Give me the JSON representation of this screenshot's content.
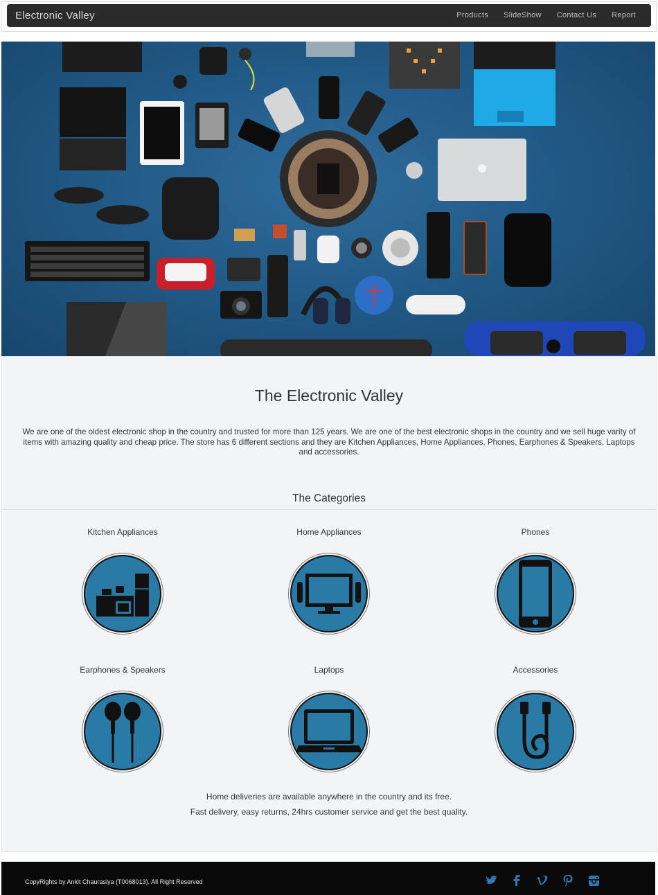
{
  "nav": {
    "brand": "Electronic Valley",
    "links": [
      "Products",
      "SlideShow",
      "Contact Us",
      "Report"
    ]
  },
  "hero": {
    "image_icon": "electronics-flatlay-photo"
  },
  "main": {
    "title": "The Electronic Valley",
    "intro": "We are one of the oldest electronic shop in the country and trusted for more than 125 years. We are one of the best electronic shops in the country and we sell huge varity of items with amazing quality and cheap price. The store has 6 different sections and they are Kitchen Appliances, Home Appliances, Phones, Earphones & Speakers, Laptops and accessories.",
    "categories_heading": "The Categories",
    "categories": [
      {
        "label": "Kitchen Appliances",
        "icon": "kitchen-icon"
      },
      {
        "label": "Home Appliances",
        "icon": "tv-icon"
      },
      {
        "label": "Phones",
        "icon": "phone-icon"
      },
      {
        "label": "Earphones & Speakers",
        "icon": "earphones-icon"
      },
      {
        "label": "Laptops",
        "icon": "laptop-icon"
      },
      {
        "label": "Accessories",
        "icon": "cable-icon"
      }
    ],
    "note1": "Home deliveries are available anywhere in the country and its free.",
    "note2": "Fast delivery, easy returns, 24hrs customer service and get the best quality."
  },
  "footer": {
    "copyright": "CopyRights by Ankit Chaurasiya (T0068013). All Right Reserved",
    "social": [
      "twitter-icon",
      "facebook-icon",
      "vimeo-icon",
      "pinterest-icon",
      "instagram-icon"
    ]
  },
  "colors": {
    "nav_bg": "#2b2b2b",
    "icon_circle": "#2a7aa6",
    "panel_bg": "#f3f4f5",
    "footer_bg": "#0a0a0a"
  }
}
